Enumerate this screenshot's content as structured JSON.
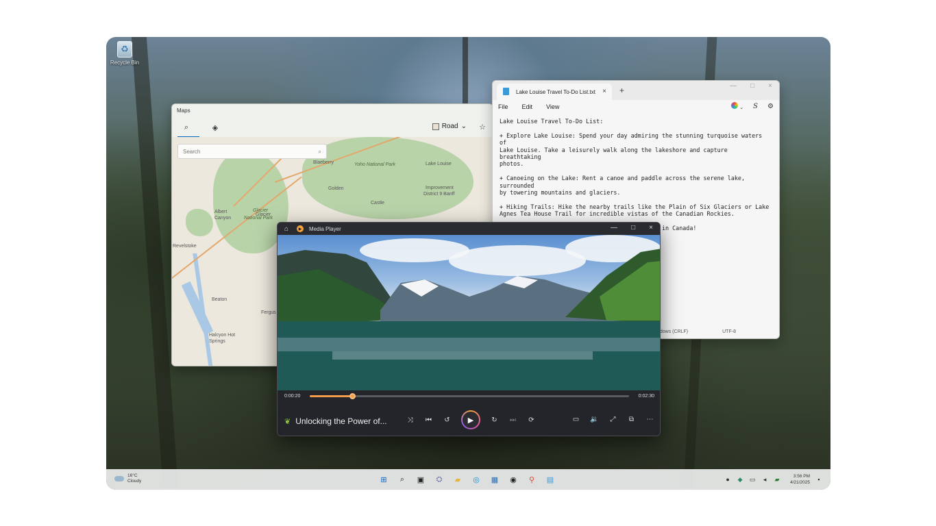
{
  "desktop": {
    "recycle_bin_label": "Recycle Bin"
  },
  "maps": {
    "title": "Maps",
    "search_placeholder": "Search",
    "map_style": "Road",
    "places": {
      "blaeberry": "Blaeberry",
      "yoho": "Yoho National Park",
      "lake_louise": "Lake Louise",
      "golden": "Golden",
      "improvement": "Improvement",
      "district": "District 9 Banff",
      "castle": "Castle",
      "albert": "Albert",
      "canyon": "Canyon",
      "glacier": "Glacier",
      "glacier_np1": "Glacier",
      "glacier_np2": "National Park",
      "revelstoke": "Revelstoke",
      "beaton": "Beaton",
      "fergus": "Fergus",
      "halcyon1": "Halcyon Hot",
      "halcyon2": "Springs"
    }
  },
  "notepad": {
    "tab_title": "Lake Louise Travel To-Do List.txt",
    "menu": [
      "File",
      "Edit",
      "View"
    ],
    "lines": [
      "Lake Louise Travel To-Do List:",
      "+ Explore Lake Louise: Spend your day admiring the stunning turquoise waters of\nLake Louise. Take a leisurely walk along the lakeshore and capture breathtaking\nphotos.",
      "+ Canoeing on the Lake: Rent a canoe and paddle across the serene lake, surrounded\nby towering mountains and glaciers.",
      "+ Hiking Trails: Hike the nearby trails like the Plain of Six Glaciers or Lake\nAgnes Tea House Trail for incredible vistas of the Canadian Rockies.",
      "Enjoy your unforgettable Lake Louise adventure in Canada!"
    ],
    "status_line_ending": "ndows (CRLF)",
    "status_encoding": "UTF-8"
  },
  "media_player": {
    "title": "Media Player",
    "current_time": "0:00:20",
    "total_time": "0:02:30",
    "progress": 0.133,
    "track_title": "Unlocking the Power of...",
    "accent": "#f39c4a"
  },
  "taskbar": {
    "temp": "16°C",
    "condition": "Cloudy",
    "time": "3:56 PM",
    "date": "4/21/2025"
  }
}
